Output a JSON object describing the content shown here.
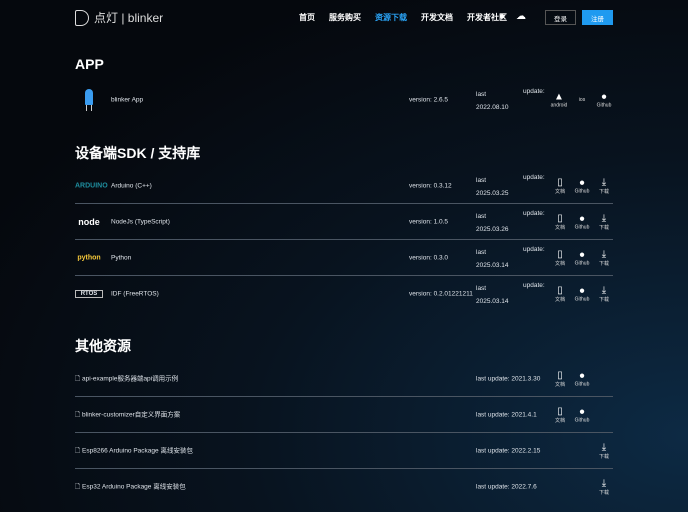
{
  "header": {
    "brand": "点灯 | blinker",
    "nav": [
      "首页",
      "服务购买",
      "资源下载",
      "开发文档",
      "开发者社区"
    ],
    "active_nav": 2,
    "login": "登录",
    "register": "注册"
  },
  "sections": {
    "app": "APP",
    "sdk": "设备端SDK / 支持库",
    "other": "其他资源"
  },
  "labels": {
    "last": "last",
    "update": "update:",
    "doc": "文档",
    "github": "Github",
    "download": "下载",
    "android": "android",
    "ios": "ios"
  },
  "app": {
    "name": "blinker App",
    "version": "version: 2.6.5",
    "date": "2022.08.10"
  },
  "sdk": [
    {
      "logo": "ARDUINO",
      "name": "Arduino (C++)",
      "version": "version: 0.3.12",
      "date": "2025.03.25"
    },
    {
      "logo": "node",
      "name": "NodeJs (TypeScript)",
      "version": "version: 1.0.5",
      "date": "2025.03.26"
    },
    {
      "logo": "python",
      "name": "Python",
      "version": "version: 0.3.0",
      "date": "2025.03.14"
    },
    {
      "logo": "RTOS",
      "name": "IDF (FreeRTOS)",
      "version": "version: 0.2.01221211",
      "date": "2025.03.14"
    }
  ],
  "other": [
    {
      "name": "api-example服务器端api调用示例",
      "updated": "last update: 2021.3.30",
      "doc": true,
      "github": true,
      "download": false
    },
    {
      "name": "blinker-customizer自定义界面方案",
      "updated": "last update: 2021.4.1",
      "doc": true,
      "github": true,
      "download": false
    },
    {
      "name": "Esp8266 Arduino Package 离线安装包",
      "updated": "last update: 2022.2.15",
      "doc": false,
      "github": false,
      "download": true
    },
    {
      "name": "Esp32 Arduino Package 离线安装包",
      "updated": "last update: 2022.7.6",
      "doc": false,
      "github": false,
      "download": true
    }
  ]
}
